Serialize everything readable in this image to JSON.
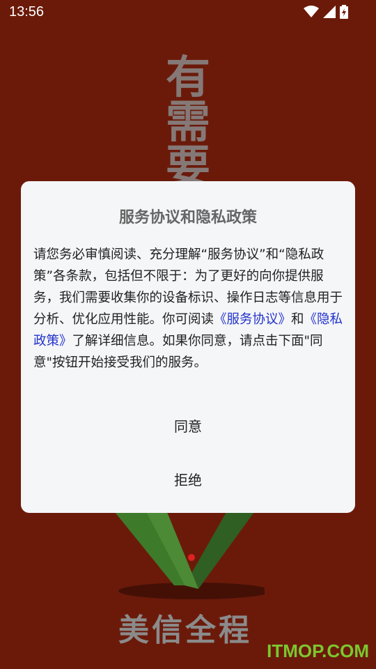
{
  "status_bar": {
    "time": "13:56"
  },
  "background": {
    "calligraphy": "有需要",
    "slogan": "美信全程"
  },
  "watermark": "ITMOP.COM",
  "dialog": {
    "title": "服务协议和隐私政策",
    "body_before": "请您务必审慎阅读、充分理解“服务协议”和“隐私政策”各条款，包括但不限于：为了更好的向你提供服务，我们需要收集你的设备标识、操作日志等信息用于分析、优化应用性能。你可阅读",
    "link_service": "《服务协议》",
    "body_and": "和",
    "link_privacy": "《隐私政策》",
    "body_after": "了解详细信息。如果你同意，请点击下面\"同意\"按钮开始接受我们的服务。",
    "agree_label": "同意",
    "reject_label": "拒绝"
  },
  "colors": {
    "background": "#6b1a0a",
    "dialog": "#f5f6f8",
    "link": "#2233cc",
    "watermark": "#7cc62f"
  }
}
